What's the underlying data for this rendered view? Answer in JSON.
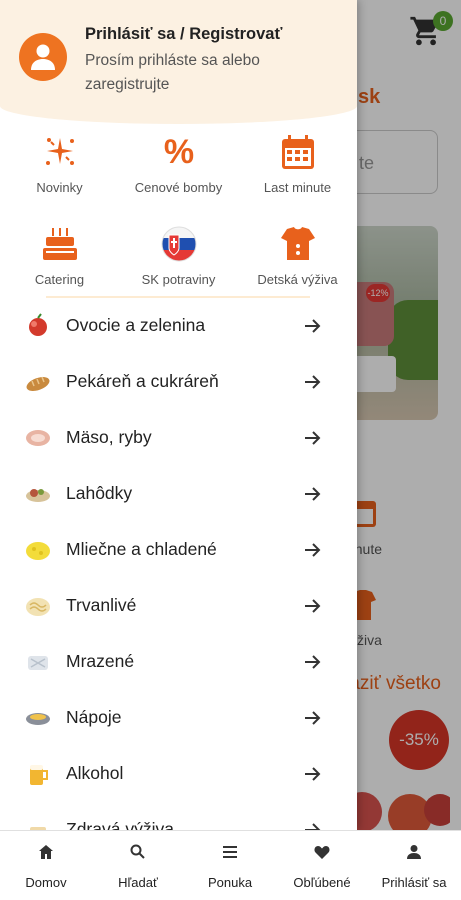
{
  "header": {
    "cart_badge": "0"
  },
  "background": {
    "brand_fragment": "sk",
    "search_fragment": "te",
    "banner_tag": "-12%",
    "calendar_label": "minute",
    "clothing_label": "výživa",
    "show_all_label": "raziť všetko",
    "discount_badge": "-35%"
  },
  "drawer": {
    "login_title": "Prihlásiť sa / Registrovať",
    "login_subtitle": "Prosím prihláste sa alebo zaregistrujte",
    "quick_links": [
      {
        "label": "Novinky",
        "icon": "sparkle-icon"
      },
      {
        "label": "Cenové bomby",
        "icon": "percent-icon"
      },
      {
        "label": "Last minute",
        "icon": "calendar-icon"
      },
      {
        "label": "Catering",
        "icon": "cake-icon"
      },
      {
        "label": "SK potraviny",
        "icon": "slovak-flag-icon"
      },
      {
        "label": "Detská výživa",
        "icon": "baby-clothes-icon"
      }
    ],
    "categories": [
      {
        "label": "Ovocie a zelenina",
        "icon": "fruit-icon"
      },
      {
        "label": "Pekáreň a cukráreň",
        "icon": "bread-icon"
      },
      {
        "label": "Mäso, ryby",
        "icon": "meat-icon"
      },
      {
        "label": "Lahôdky",
        "icon": "deli-icon"
      },
      {
        "label": "Mliečne a chladené",
        "icon": "cheese-icon"
      },
      {
        "label": "Trvanlivé",
        "icon": "pasta-icon"
      },
      {
        "label": "Mrazené",
        "icon": "frozen-icon"
      },
      {
        "label": "Nápoje",
        "icon": "drinks-icon"
      },
      {
        "label": "Alkohol",
        "icon": "beer-icon"
      },
      {
        "label": "Zdravá výživa",
        "icon": "health-icon"
      }
    ],
    "accent_color": "#ee7321"
  },
  "bottom_nav": [
    {
      "label": "Domov",
      "icon": "home-icon"
    },
    {
      "label": "Hľadať",
      "icon": "search-icon"
    },
    {
      "label": "Ponuka",
      "icon": "menu-icon"
    },
    {
      "label": "Obľúbené",
      "icon": "heart-icon"
    },
    {
      "label": "Prihlásiť sa",
      "icon": "person-icon"
    }
  ]
}
